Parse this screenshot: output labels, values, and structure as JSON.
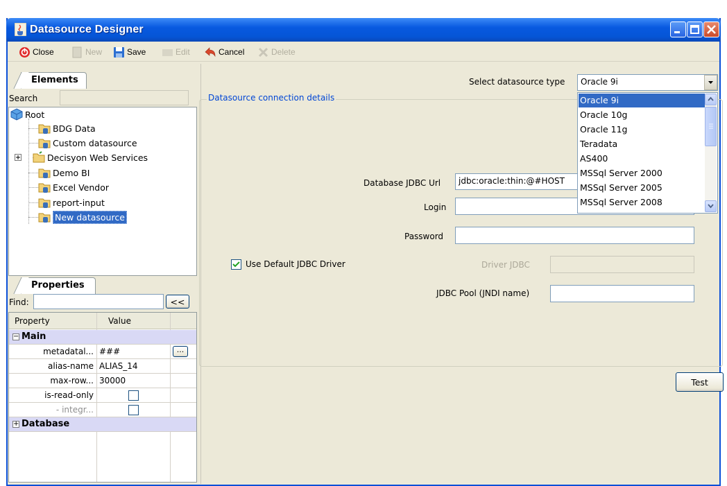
{
  "window": {
    "title": "Datasource Designer"
  },
  "toolbar": {
    "close_label": "Close",
    "new_label": "New",
    "save_label": "Save",
    "edit_label": "Edit",
    "cancel_label": "Cancel",
    "delete_label": "Delete"
  },
  "elements": {
    "tab_label": "Elements",
    "search_label": "Search",
    "search_value": "",
    "tree": [
      {
        "label": "Root"
      },
      {
        "label": "BDG Data"
      },
      {
        "label": "Custom datasource"
      },
      {
        "label": "Decisyon Web Services"
      },
      {
        "label": "Demo BI"
      },
      {
        "label": "Excel Vendor"
      },
      {
        "label": "report-input"
      },
      {
        "label": "New datasource"
      }
    ]
  },
  "properties": {
    "tab_label": "Properties",
    "find_label": "Find:",
    "find_value": "",
    "collapse_label": "<<",
    "col_property": "Property",
    "col_value": "Value",
    "group_main": "Main",
    "group_database": "Database",
    "rows": [
      {
        "name": "metadatal...",
        "value": "###",
        "more": "..."
      },
      {
        "name": "alias-name",
        "value": "ALIAS_14"
      },
      {
        "name": "max-row...",
        "value": "30000"
      },
      {
        "name": "is-read-only",
        "value": ""
      },
      {
        "name": "- integr...",
        "value": ""
      }
    ]
  },
  "connection": {
    "select_type_label": "Select datasource type",
    "select_type_value": "Oracle 9i",
    "group_label": "Datasource connection details",
    "jdbc_url_label": "Database JDBC Url",
    "jdbc_url_value": "jdbc:oracle:thin:@#HOST",
    "login_label": "Login",
    "login_value": "",
    "password_label": "Password",
    "password_value": "",
    "use_default_label": "Use Default JDBC Driver",
    "use_default_checked": true,
    "driver_label": "Driver JDBC",
    "driver_value": "",
    "pool_label": "JDBC Pool (JNDI name)",
    "pool_value": "",
    "test_label": "Test"
  },
  "dropdown": {
    "options": [
      "Oracle 9i",
      "Oracle 10g",
      "Oracle 11g",
      "Teradata",
      "AS400",
      "MSSql Server 2000",
      "MSSql Server 2005",
      "MSSql Server 2008"
    ],
    "selected": "Oracle 9i"
  },
  "colors": {
    "titlebar": "#0555d6",
    "selection": "#316ac5",
    "group_label": "#0046d5",
    "group_row": "#d9d9f5"
  }
}
